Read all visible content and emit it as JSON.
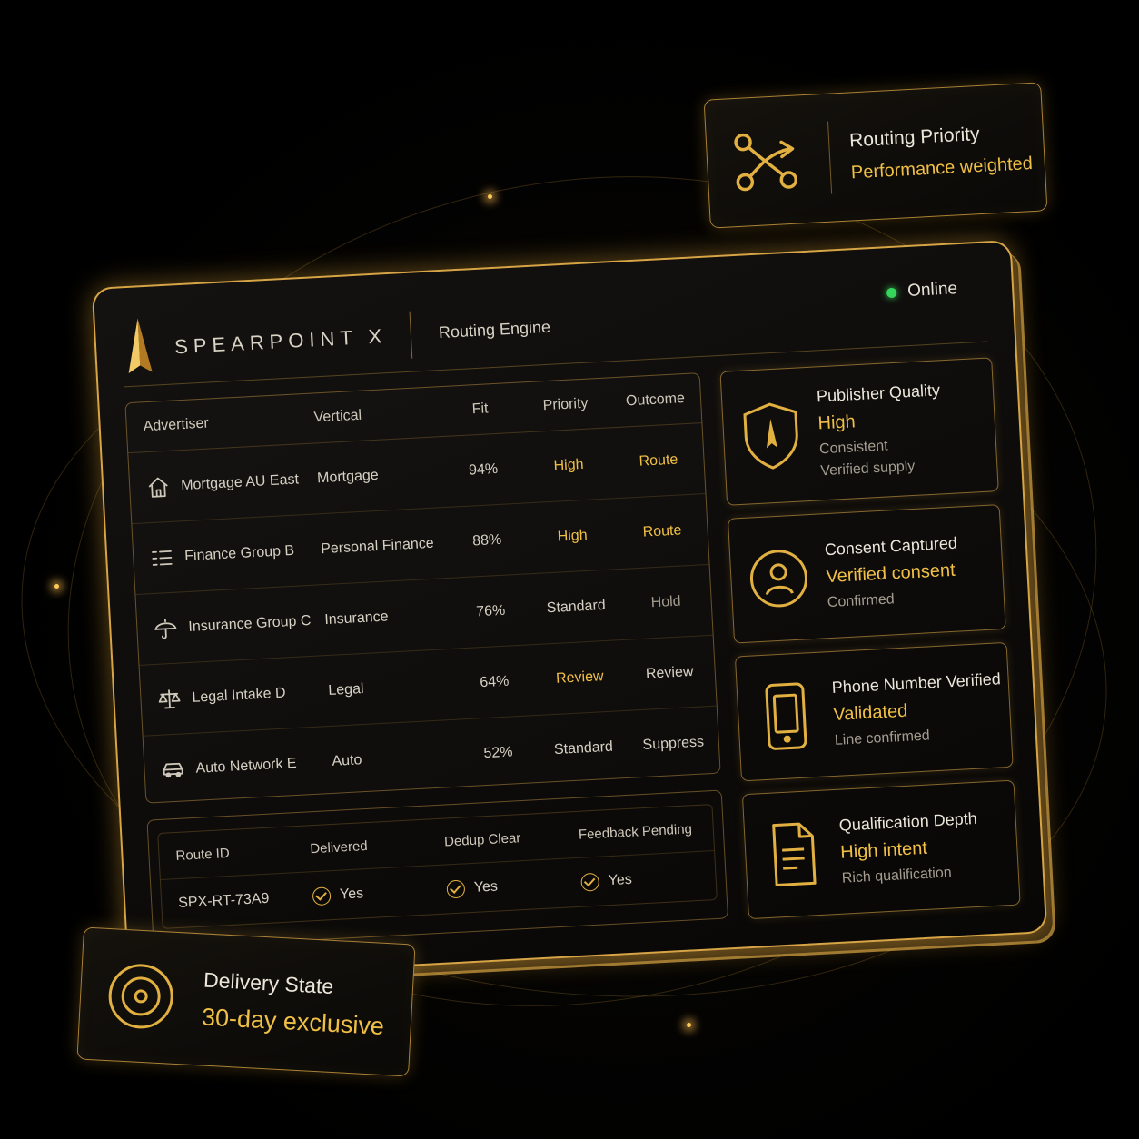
{
  "brand": {
    "name": "SPEARPOINT X",
    "subtitle": "Routing Engine"
  },
  "status": {
    "label": "Online",
    "color": "#35d65b"
  },
  "colors": {
    "accent": "#f0bf45",
    "border": "#d7a546",
    "background": "#000000"
  },
  "routing_card": {
    "icon": "route-split-icon",
    "title": "Routing Priority",
    "value": "Performance weighted"
  },
  "table": {
    "headers": {
      "advertiser": "Advertiser",
      "vertical": "Vertical",
      "fit": "Fit",
      "priority": "Priority",
      "outcome": "Outcome"
    },
    "rows": [
      {
        "icon": "house-icon",
        "advertiser": "Mortgage AU East",
        "vertical": "Mortgage",
        "fit": "94%",
        "priority": "High",
        "outcome": "Route"
      },
      {
        "icon": "list-icon",
        "advertiser": "Finance Group B",
        "vertical": "Personal Finance",
        "fit": "88%",
        "priority": "High",
        "outcome": "Route"
      },
      {
        "icon": "umbrella-icon",
        "advertiser": "Insurance Group C",
        "vertical": "Insurance",
        "fit": "76%",
        "priority": "Standard",
        "outcome": "Hold"
      },
      {
        "icon": "scales-icon",
        "advertiser": "Legal Intake D",
        "vertical": "Legal",
        "fit": "64%",
        "priority": "Review",
        "outcome": "Review"
      },
      {
        "icon": "car-icon",
        "advertiser": "Auto Network E",
        "vertical": "Auto",
        "fit": "52%",
        "priority": "Standard",
        "outcome": "Suppress"
      }
    ]
  },
  "route": {
    "headers": {
      "id": "Route ID",
      "delivered": "Delivered",
      "dedup": "Dedup Clear",
      "feedback": "Feedback Pending"
    },
    "values": {
      "id": "SPX-RT-73A9",
      "delivered": "Yes",
      "dedup": "Yes",
      "feedback": "Yes"
    }
  },
  "side_cards": [
    {
      "icon": "shield-icon",
      "title": "Publisher Quality",
      "value": "High",
      "note1": "Consistent",
      "note2": "Verified supply"
    },
    {
      "icon": "user-icon",
      "title": "Consent Captured",
      "value": "Verified consent",
      "note1": "Confirmed"
    },
    {
      "icon": "phone-icon",
      "title": "Phone Number Verified",
      "value": "Validated",
      "note1": "Line confirmed"
    },
    {
      "icon": "document-icon",
      "title": "Qualification Depth",
      "value": "High intent",
      "note1": "Rich qualification"
    }
  ],
  "delivery_card": {
    "icon": "target-icon",
    "title": "Delivery State",
    "value": "30-day exclusive"
  }
}
